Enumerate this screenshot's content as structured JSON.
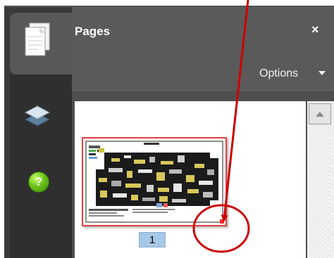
{
  "panel": {
    "title": "Pages",
    "close_label": "×",
    "options_label": "Options"
  },
  "rail": {
    "icons": [
      "pages-icon",
      "layers-icon",
      "help-icon"
    ],
    "help_glyph": "?"
  },
  "thumbnail": {
    "page_label": "1",
    "selected": true
  },
  "annotation": {
    "color": "#cc0000"
  },
  "colors": {
    "panel_dark": "#3b3b3b",
    "panel_head": "#5a5a5a",
    "thumb_border": "#e34040",
    "page_badge": "#a6c8e6",
    "help_icon": "#6cc21c"
  }
}
